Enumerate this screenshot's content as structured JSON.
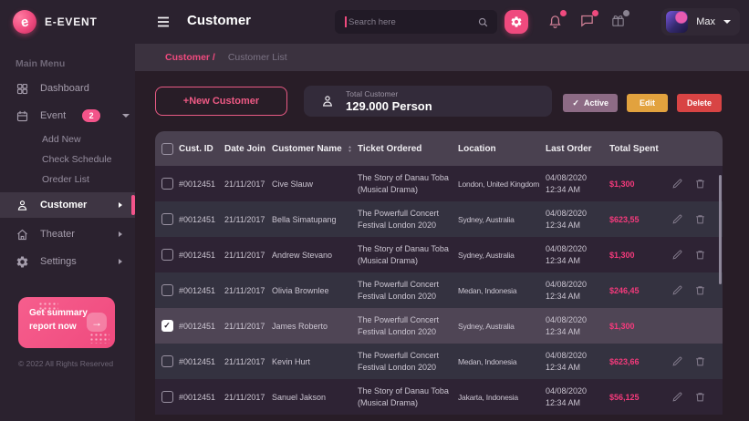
{
  "brand": {
    "name": "E-EVENT"
  },
  "colors": {
    "accent": "#ef4a7e",
    "active_btn": "#8d6b85",
    "edit_btn": "#e2a23e",
    "delete_btn": "#d84444",
    "total_spent": "#f53a7c"
  },
  "icons": {
    "check": "✓",
    "arrow_right": "→"
  },
  "header": {
    "title": "Customer",
    "search_placeholder": "Search here",
    "user_name": "Max"
  },
  "breadcrumb": {
    "section": "Customer /",
    "page": "Customer List"
  },
  "sidebar": {
    "section_label": "Main Menu",
    "dashboard_label": "Dashboard",
    "event_label": "Event",
    "event_badge": "2",
    "event_sub": [
      "Add New",
      "Check Schedule",
      "Oreder List"
    ],
    "customer_label": "Customer",
    "theater_label": "Theater",
    "settings_label": "Settings",
    "summary_line1": "Get summary",
    "summary_line2": "report now",
    "copyright": "© 2022 All Rights Reserved"
  },
  "toolbar": {
    "new_customer_label": "+New Customer",
    "total_label": "Total Customer",
    "total_value": "129.000 Person",
    "active_label": "Active",
    "edit_label": "Edit",
    "delete_label": "Delete"
  },
  "table": {
    "columns": [
      "Cust. ID",
      "Date Join",
      "Customer Name",
      "Ticket Ordered",
      "Location",
      "Last Order",
      "Total Spent"
    ],
    "rows": [
      {
        "id": "#0012451",
        "date_join": "21/11/2017",
        "name": "Cive Slauw",
        "ticket": "The Story of Danau Toba (Musical Drama)",
        "location": "London, United Kingdom",
        "order_date": "04/08/2020",
        "order_time": "12:34 AM",
        "total": "$1,300",
        "checked": false
      },
      {
        "id": "#0012451",
        "date_join": "21/11/2017",
        "name": "Bella Simatupang",
        "ticket": "The Powerfull Concert Festival London 2020",
        "location": "Sydney, Australia",
        "order_date": "04/08/2020",
        "order_time": "12:34 AM",
        "total": "$623,55",
        "checked": false
      },
      {
        "id": "#0012451",
        "date_join": "21/11/2017",
        "name": "Andrew Stevano",
        "ticket": "The Story of Danau Toba (Musical Drama)",
        "location": "Sydney, Australia",
        "order_date": "04/08/2020",
        "order_time": "12:34 AM",
        "total": "$1,300",
        "checked": false
      },
      {
        "id": "#0012451",
        "date_join": "21/11/2017",
        "name": "Olivia Brownlee",
        "ticket": "The Powerfull Concert Festival London 2020",
        "location": "Medan, Indonesia",
        "order_date": "04/08/2020",
        "order_time": "12:34 AM",
        "total": "$246,45",
        "checked": false
      },
      {
        "id": "#0012451",
        "date_join": "21/11/2017",
        "name": "James Roberto",
        "ticket": "The Powerfull Concert Festival London 2020",
        "location": "Sydney, Australia",
        "order_date": "04/08/2020",
        "order_time": "12:34 AM",
        "total": "$1,300",
        "checked": true
      },
      {
        "id": "#0012451",
        "date_join": "21/11/2017",
        "name": "Kevin Hurt",
        "ticket": "The Powerfull Concert Festival London 2020",
        "location": "Medan, Indonesia",
        "order_date": "04/08/2020",
        "order_time": "12:34 AM",
        "total": "$623,66",
        "checked": false
      },
      {
        "id": "#0012451",
        "date_join": "21/11/2017",
        "name": "Sanuel Jakson",
        "ticket": "The Story of Danau Toba (Musical Drama)",
        "location": "Jakarta, Indonesia",
        "order_date": "04/08/2020",
        "order_time": "12:34 AM",
        "total": "$56,125",
        "checked": false
      }
    ]
  }
}
